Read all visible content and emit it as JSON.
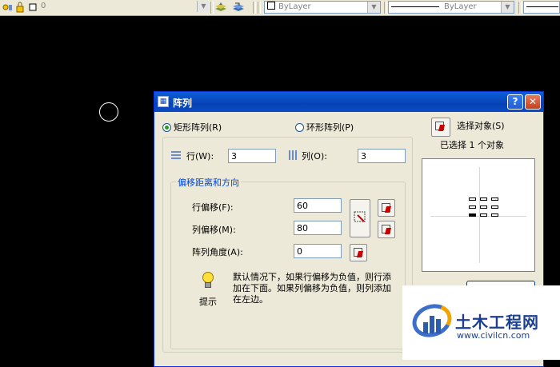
{
  "toolbar": {
    "layer_value": "0",
    "color_value": "ByLayer",
    "linetype_value": "ByLayer"
  },
  "dialog": {
    "title": "阵列",
    "help_label": "?",
    "close_label": "✕",
    "rect_array_label": "矩形阵列(R)",
    "polar_array_label": "环形阵列(P)",
    "rows_label": "行(W):",
    "rows_value": "3",
    "cols_label": "列(O):",
    "cols_value": "3",
    "offset_group_label": "偏移距离和方向",
    "row_offset_label": "行偏移(F):",
    "row_offset_value": "60",
    "col_offset_label": "列偏移(M):",
    "col_offset_value": "80",
    "angle_label": "阵列角度(A):",
    "angle_value": "0",
    "tip_label": "提示",
    "tip_text": "默认情况下，如果行偏移为负值，则行添加在下面。如果列偏移为负值，则列添加在左边。",
    "select_objects_label": "选择对象(S)",
    "selected_count_label": "已选择 1 个对象"
  },
  "watermark": {
    "name": "土木工程网",
    "url": "www.civilcn.com"
  }
}
